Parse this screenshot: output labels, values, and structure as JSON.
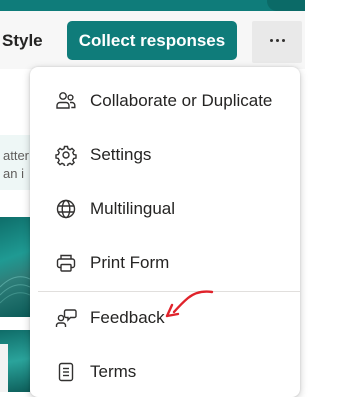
{
  "toolbar": {
    "style_label": "Style",
    "collect_label": "Collect responses",
    "more_icon": "more-horizontal-icon"
  },
  "background": {
    "line1": "atter",
    "line2": "an i"
  },
  "menu": {
    "items": [
      {
        "label": "Collaborate or Duplicate",
        "icon": "people-icon"
      },
      {
        "label": "Settings",
        "icon": "gear-icon"
      },
      {
        "label": "Multilingual",
        "icon": "globe-icon"
      },
      {
        "label": "Print Form",
        "icon": "printer-icon"
      },
      {
        "label": "Feedback",
        "icon": "feedback-icon"
      },
      {
        "label": "Terms",
        "icon": "document-icon"
      }
    ]
  },
  "colors": {
    "accent": "#0f7c7a",
    "annotation": "#e0232b"
  }
}
